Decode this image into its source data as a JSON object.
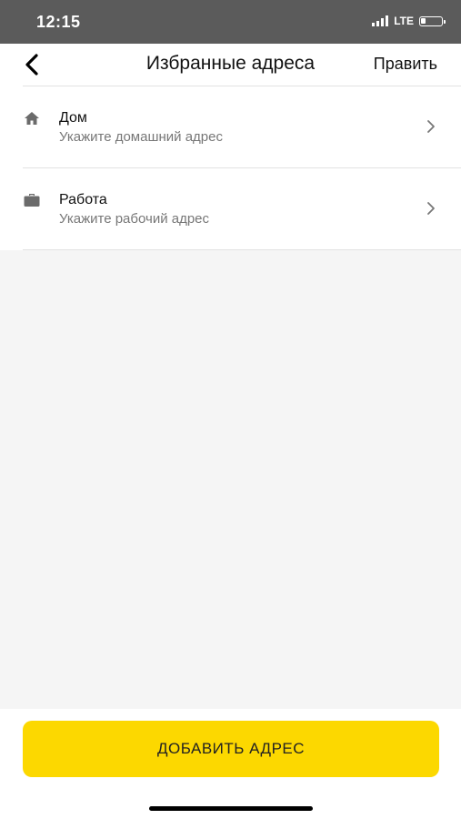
{
  "status_bar": {
    "time": "12:15",
    "network": "LTE",
    "battery_level_percent": 20
  },
  "header": {
    "back_icon": "chevron-left-icon",
    "title": "Избранные адреса",
    "edit_label": "Править"
  },
  "addresses": [
    {
      "icon": "home-icon",
      "title": "Дом",
      "subtitle": "Укажите домашний адрес"
    },
    {
      "icon": "briefcase-icon",
      "title": "Работа",
      "subtitle": "Укажите рабочий адрес"
    }
  ],
  "footer": {
    "add_button_label": "ДОБАВИТЬ АДРЕС"
  },
  "colors": {
    "accent": "#fcd800",
    "status_bar": "#5b5b5b",
    "background": "#f5f5f5",
    "secondary_text": "#777777"
  }
}
